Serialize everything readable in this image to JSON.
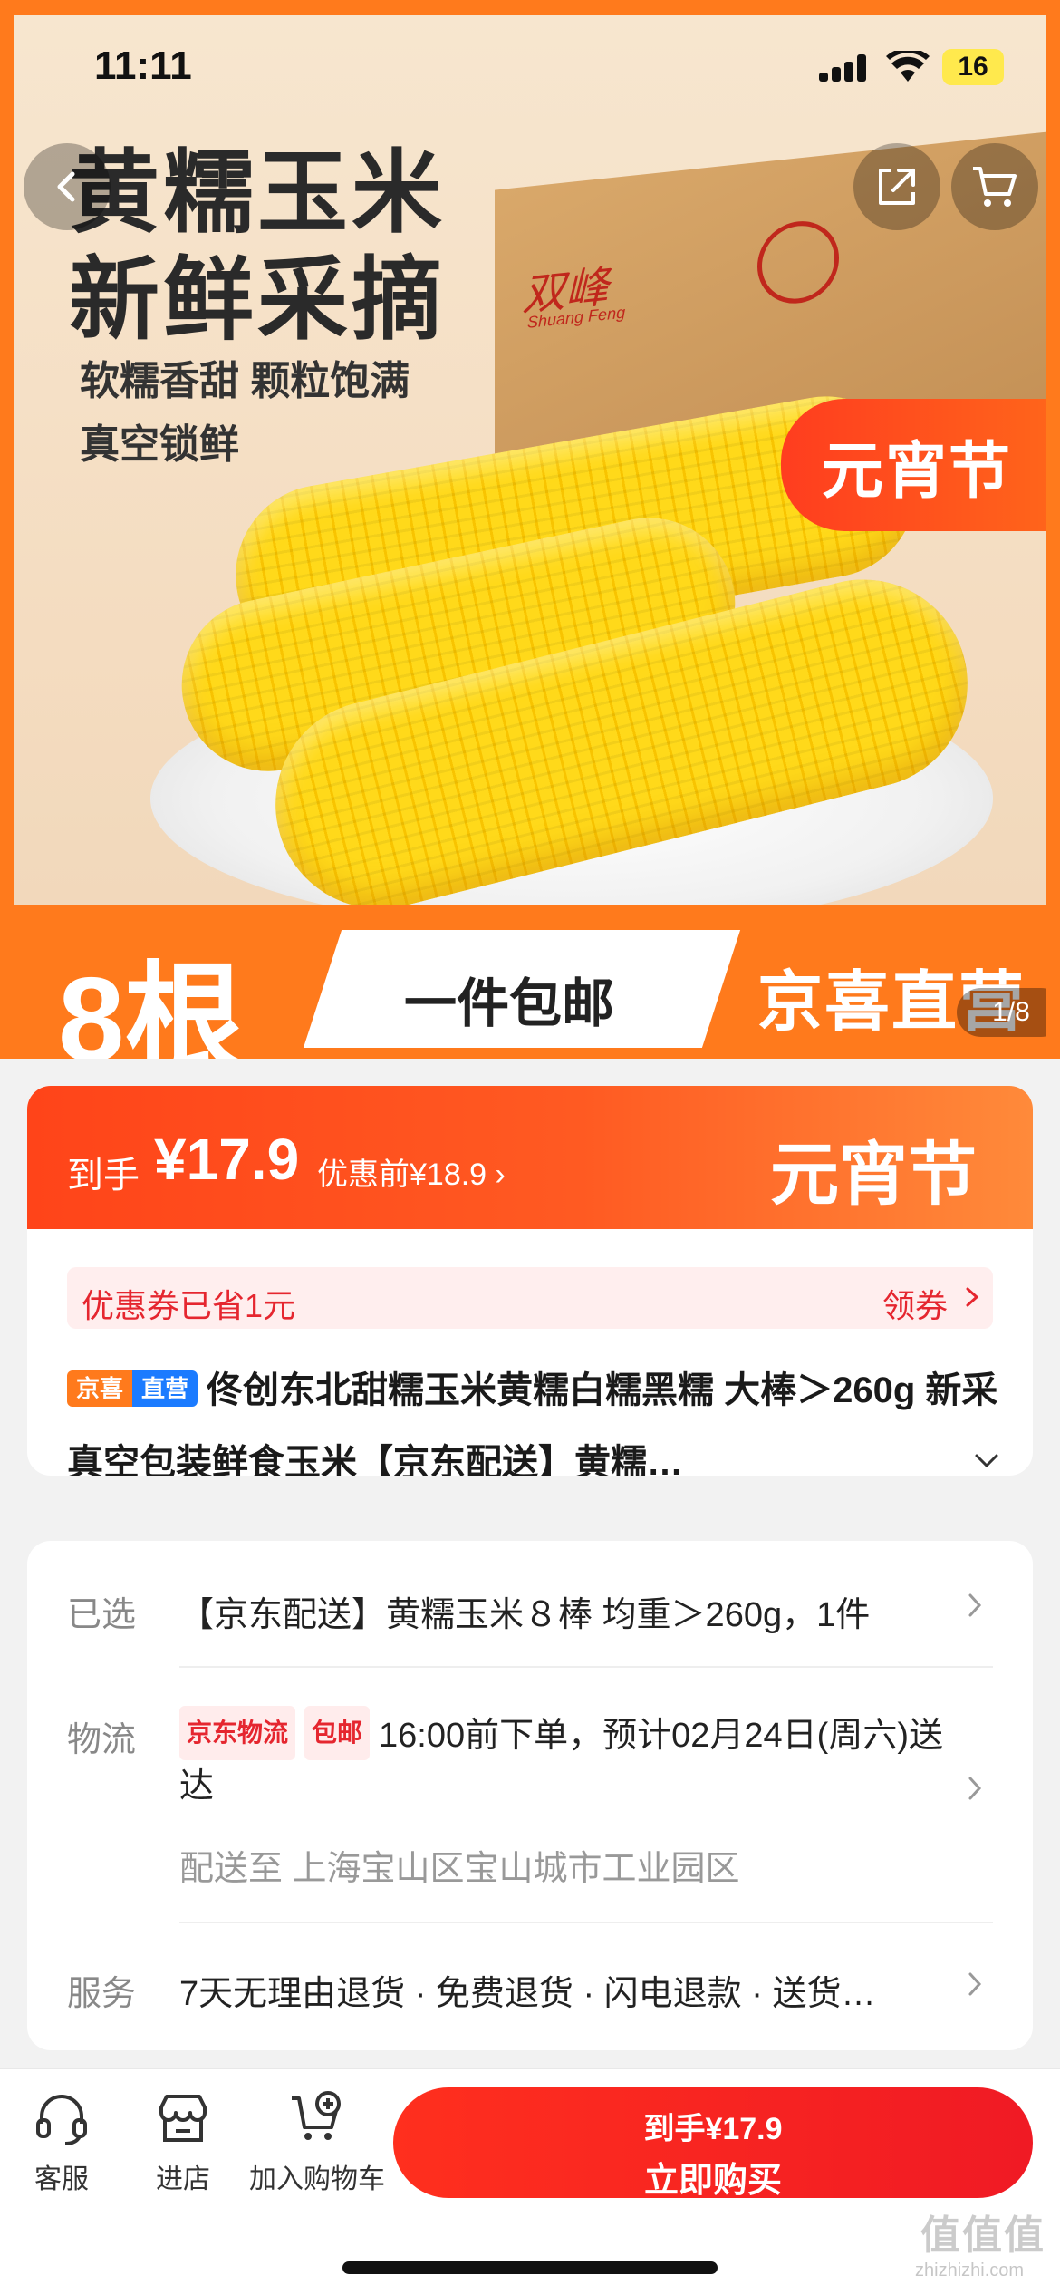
{
  "status": {
    "time": "11:11",
    "battery": "16"
  },
  "hero": {
    "title_line1": "黄糯玉米",
    "title_line2": "新鲜采摘",
    "sub_line1": "软糯香甜 颗粒饱满",
    "sub_line2": "真空锁鲜",
    "box_brand": "双峰",
    "box_brand_en": "Shuang Feng",
    "festival": "元宵节",
    "count": "8根",
    "shipping": "一件包邮",
    "store_brand": "京喜直营",
    "pager": "1/8"
  },
  "price": {
    "label": "到手",
    "value": "¥17.9",
    "original": "优惠前¥18.9 ›",
    "festival": "元宵节"
  },
  "coupon": {
    "left": "优惠券已省1元",
    "right": "领券"
  },
  "product": {
    "tag_a": "京喜",
    "tag_b": "直营",
    "title": "佟创东北甜糯玉米黄糯白糯黑糯 大棒＞260g 新采真空包装鲜食玉米【京东配送】黄糯…"
  },
  "info": {
    "selected_label": "已选",
    "selected_value": "【京东配送】黄糯玉米８棒 均重＞260g，1件",
    "logistics_label": "物流",
    "logistics_tag1": "京东物流",
    "logistics_tag2": "包邮",
    "logistics_value": "16:00前下单，预计02月24日(周六)送达",
    "address": "配送至 上海宝山区宝山城市工业园区",
    "service_label": "服务",
    "service_value": "7天无理由退货 · 免费退货 · 闪电退款 · 送货…"
  },
  "bottom": {
    "service": "客服",
    "store": "进店",
    "add_cart": "加入购物车",
    "buy_price": "到手¥17.9",
    "buy_label": "立即购买"
  },
  "watermark": {
    "main": "值值值",
    "sub": "zhizhizhi.com"
  },
  "colors": {
    "accent": "#ff7a1c",
    "buy": "#f01a24",
    "price_red": "#ff4419",
    "coupon_red": "#e5262f"
  }
}
